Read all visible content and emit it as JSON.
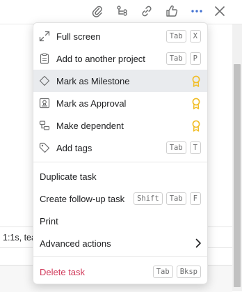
{
  "toolbar": {
    "icons": [
      "attachment-icon",
      "subtasks-icon",
      "link-icon",
      "like-icon",
      "more-icon",
      "close-icon"
    ],
    "accent": "#4573d2"
  },
  "background": {
    "snippet": "1:1s, tea"
  },
  "menu": {
    "full_screen": {
      "label": "Full screen",
      "keys": [
        "Tab",
        "X"
      ]
    },
    "add_to_project": {
      "label": "Add to another project",
      "keys": [
        "Tab",
        "P"
      ]
    },
    "mark_milestone": {
      "label": "Mark as Milestone"
    },
    "mark_approval": {
      "label": "Mark as Approval"
    },
    "make_dependent": {
      "label": "Make dependent"
    },
    "add_tags": {
      "label": "Add tags",
      "keys": [
        "Tab",
        "T"
      ]
    },
    "duplicate": {
      "label": "Duplicate task"
    },
    "follow_up": {
      "label": "Create follow-up task",
      "keys": [
        "Shift",
        "Tab",
        "F"
      ]
    },
    "print": {
      "label": "Print"
    },
    "advanced": {
      "label": "Advanced actions"
    },
    "delete": {
      "label": "Delete task",
      "keys": [
        "Tab",
        "Bksp"
      ]
    }
  },
  "colors": {
    "premium": "#f1bd25",
    "danger": "#d1395a",
    "selected_row": "#e9ebee"
  }
}
